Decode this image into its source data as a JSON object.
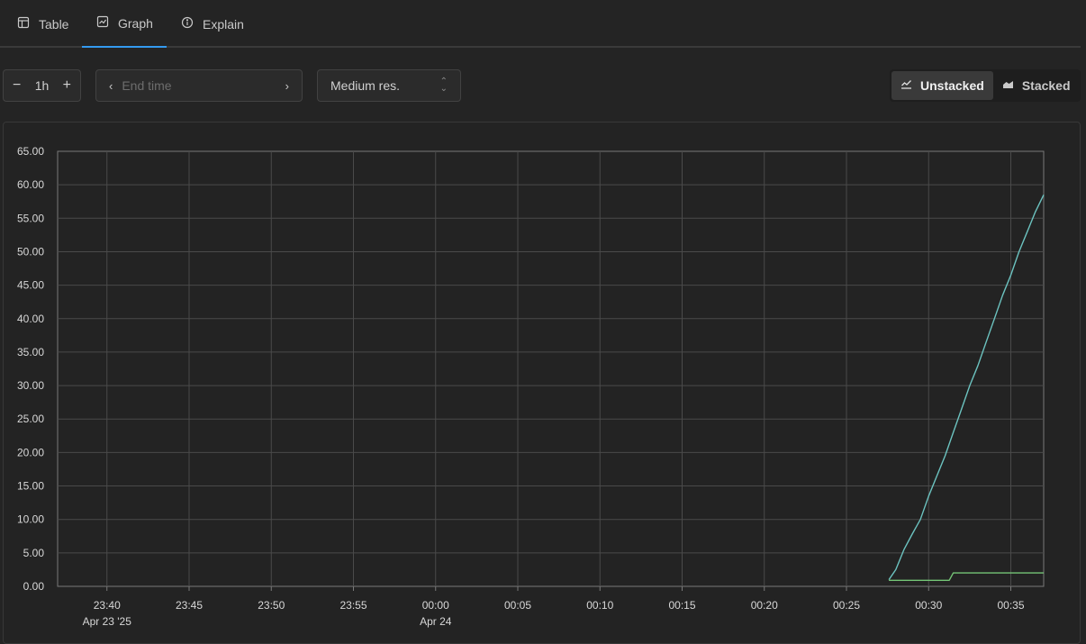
{
  "tabs": [
    {
      "label": "Table",
      "icon": "table-icon",
      "active": false
    },
    {
      "label": "Graph",
      "icon": "graph-icon",
      "active": true
    },
    {
      "label": "Explain",
      "icon": "info-icon",
      "active": false
    }
  ],
  "controls": {
    "range": {
      "minus": "−",
      "value": "1h",
      "plus": "+"
    },
    "end_time": {
      "placeholder": "End time",
      "prev": "‹",
      "next": "›"
    },
    "resolution": {
      "value": "Medium res."
    }
  },
  "stack_toggle": {
    "unstacked_label": "Unstacked",
    "stacked_label": "Stacked",
    "selected": "Unstacked"
  },
  "colors": {
    "accent": "#339af0",
    "series_1": "#6cc3c0",
    "series_2": "#74c476",
    "grid": "#4a4a4a"
  },
  "chart_data": {
    "type": "line",
    "ylim": [
      0,
      65
    ],
    "y_ticks": [
      "0.00",
      "5.00",
      "10.00",
      "15.00",
      "20.00",
      "25.00",
      "30.00",
      "35.00",
      "40.00",
      "45.00",
      "50.00",
      "55.00",
      "60.00",
      "65.00"
    ],
    "x_range": [
      "23:37",
      "00:37"
    ],
    "x_ticks": [
      {
        "time": "23:40",
        "sub": "Apr 23 '25"
      },
      {
        "time": "23:45",
        "sub": ""
      },
      {
        "time": "23:50",
        "sub": ""
      },
      {
        "time": "23:55",
        "sub": ""
      },
      {
        "time": "00:00",
        "sub": "Apr 24"
      },
      {
        "time": "00:05",
        "sub": ""
      },
      {
        "time": "00:10",
        "sub": ""
      },
      {
        "time": "00:15",
        "sub": ""
      },
      {
        "time": "00:20",
        "sub": ""
      },
      {
        "time": "00:25",
        "sub": ""
      },
      {
        "time": "00:30",
        "sub": ""
      },
      {
        "time": "00:35",
        "sub": ""
      }
    ],
    "grid": true,
    "series": [
      {
        "color": "#6cc3c0",
        "points": [
          [
            "00:27:35",
            1
          ],
          [
            "00:28:00",
            2.5
          ],
          [
            "00:28:30",
            5.5
          ],
          [
            "00:29:00",
            7.8
          ],
          [
            "00:29:30",
            10
          ],
          [
            "00:30:00",
            13.5
          ],
          [
            "00:30:30",
            16.5
          ],
          [
            "00:31:00",
            19.5
          ],
          [
            "00:31:30",
            23
          ],
          [
            "00:32:00",
            26.5
          ],
          [
            "00:32:30",
            30
          ],
          [
            "00:33:00",
            33
          ],
          [
            "00:33:30",
            36.5
          ],
          [
            "00:34:00",
            40
          ],
          [
            "00:34:30",
            43.5
          ],
          [
            "00:35:00",
            46.5
          ],
          [
            "00:35:30",
            50
          ],
          [
            "00:36:00",
            53
          ],
          [
            "00:36:30",
            56
          ],
          [
            "00:37:00",
            58.5
          ]
        ]
      },
      {
        "color": "#74c476",
        "points": [
          [
            "00:27:35",
            0.9
          ],
          [
            "00:31:15",
            0.9
          ],
          [
            "00:31:30",
            2
          ],
          [
            "00:37:00",
            2
          ]
        ]
      }
    ]
  }
}
